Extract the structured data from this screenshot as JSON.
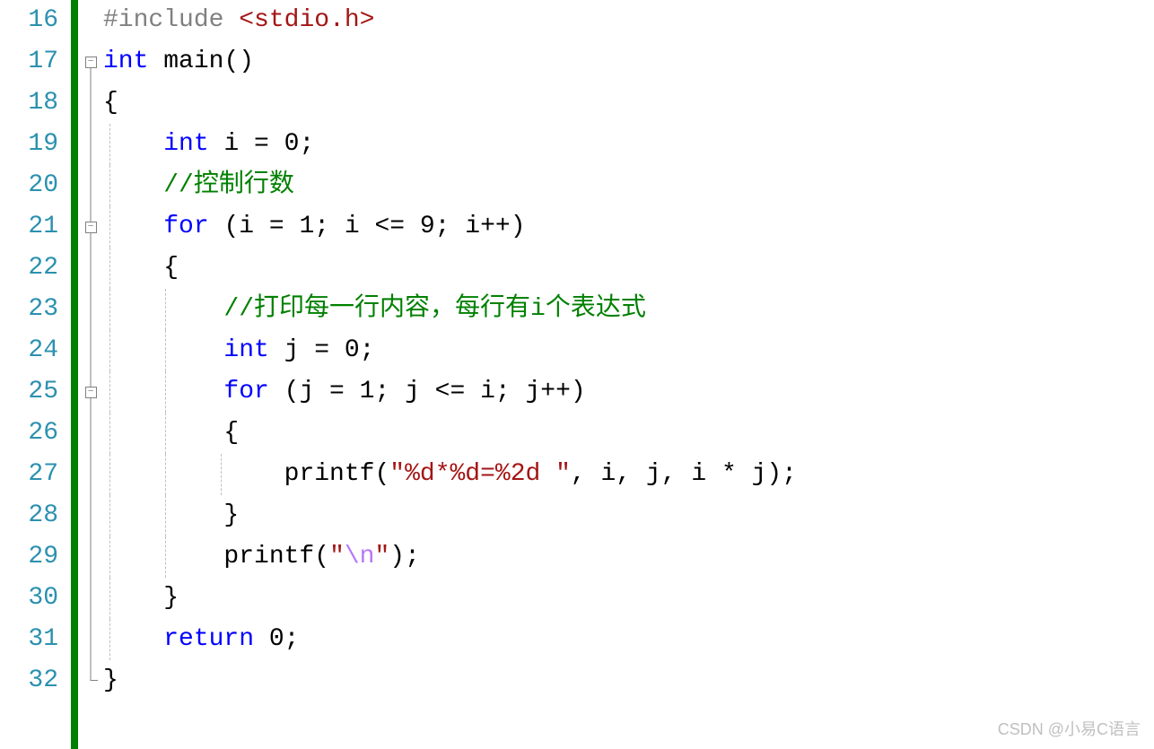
{
  "lines": {
    "start": 16,
    "end": 32,
    "numbers": [
      "16",
      "17",
      "18",
      "19",
      "20",
      "21",
      "22",
      "23",
      "24",
      "25",
      "26",
      "27",
      "28",
      "29",
      "30",
      "31",
      "32"
    ]
  },
  "fold": {
    "box_glyph": "−",
    "positions": [
      17,
      21,
      25
    ]
  },
  "code": {
    "l16": {
      "preproc": "#include ",
      "inc": "<stdio.h>"
    },
    "l17": {
      "type": "int",
      "func": " main",
      "rest": "()"
    },
    "l18": {
      "brace": "{"
    },
    "l19": {
      "indent": "    ",
      "type": "int",
      "rest": " i = 0;"
    },
    "l20": {
      "indent": "    ",
      "comment": "//控制行数"
    },
    "l21": {
      "indent": "    ",
      "kw": "for",
      "rest": " (i = 1; i <= 9; i++)"
    },
    "l22": {
      "indent": "    ",
      "brace": "{"
    },
    "l23": {
      "indent": "        ",
      "comment": "//打印每一行内容，每行有i个表达式"
    },
    "l24": {
      "indent": "        ",
      "type": "int",
      "rest": " j = 0;"
    },
    "l25": {
      "indent": "        ",
      "kw": "for",
      "rest": " (j = 1; j <= i; j++)"
    },
    "l26": {
      "indent": "        ",
      "brace": "{"
    },
    "l27": {
      "indent": "            ",
      "func": "printf",
      "p1": "(",
      "str1": "\"%d*%d=%2d \"",
      "rest": ", i, j, i * j);"
    },
    "l28": {
      "indent": "        ",
      "brace": "}"
    },
    "l29": {
      "indent": "        ",
      "func": "printf",
      "p1": "(",
      "str_open": "\"",
      "escape": "\\n",
      "str_close": "\"",
      "rest": ");"
    },
    "l30": {
      "indent": "    ",
      "brace": "}"
    },
    "l31": {
      "indent": "    ",
      "kw": "return",
      "rest": " 0;"
    },
    "l32": {
      "brace": "}"
    }
  },
  "watermark": "CSDN @小易C语言"
}
